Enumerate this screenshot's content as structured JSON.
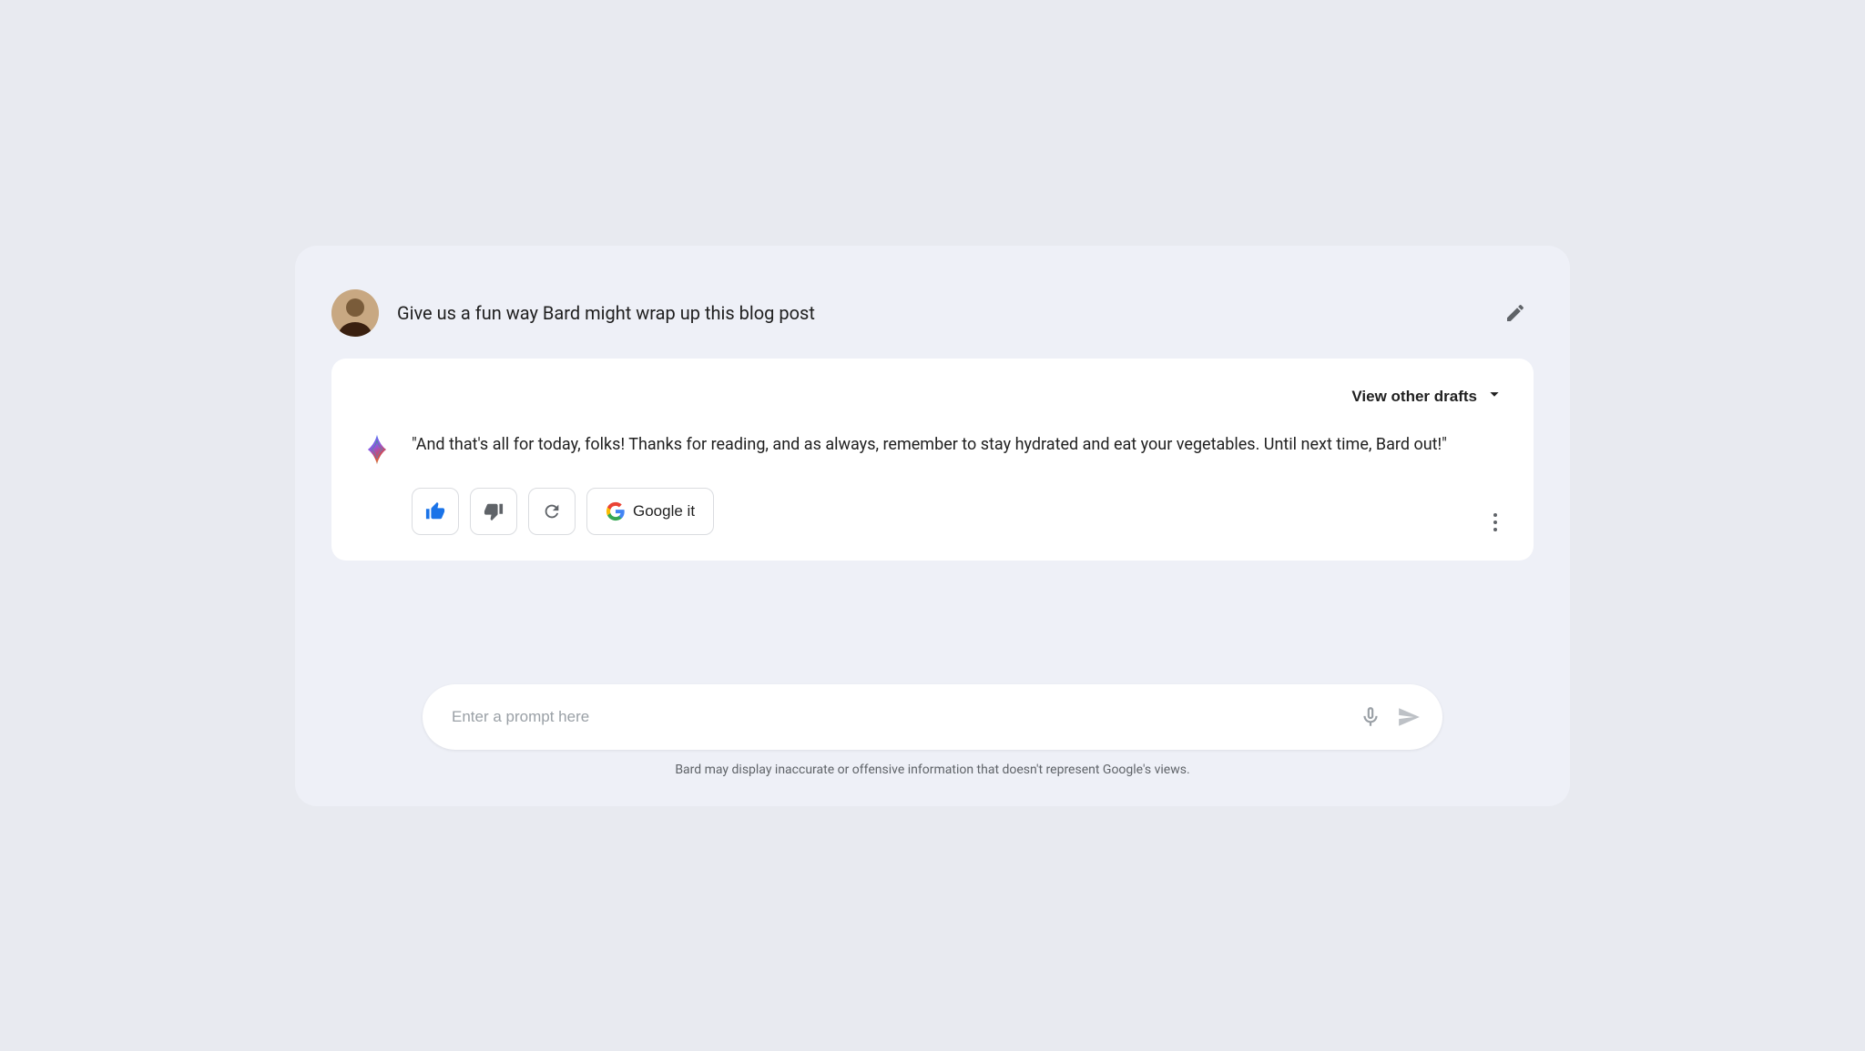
{
  "user": {
    "query": "Give us a fun way Bard might wrap up this blog post"
  },
  "response": {
    "view_drafts_label": "View other drafts",
    "text": "\"And that's all for today, folks! Thanks for reading, and as always, remember to stay hydrated and eat your vegetables. Until next time, Bard out!\"",
    "actions": {
      "thumbs_up_label": "👍",
      "thumbs_down_label": "👎",
      "regenerate_label": "↻",
      "google_it_label": "Google it"
    }
  },
  "input": {
    "placeholder": "Enter a prompt here"
  },
  "disclaimer": "Bard may display inaccurate or offensive information that doesn't represent Google's views.",
  "icons": {
    "edit": "pencil-icon",
    "chevron_down": "chevron-down-icon",
    "mic": "microphone-icon",
    "send": "send-icon",
    "more": "more-options-icon",
    "thumbs_up": "thumbs-up-icon",
    "thumbs_down": "thumbs-down-icon",
    "regenerate": "regenerate-icon"
  }
}
